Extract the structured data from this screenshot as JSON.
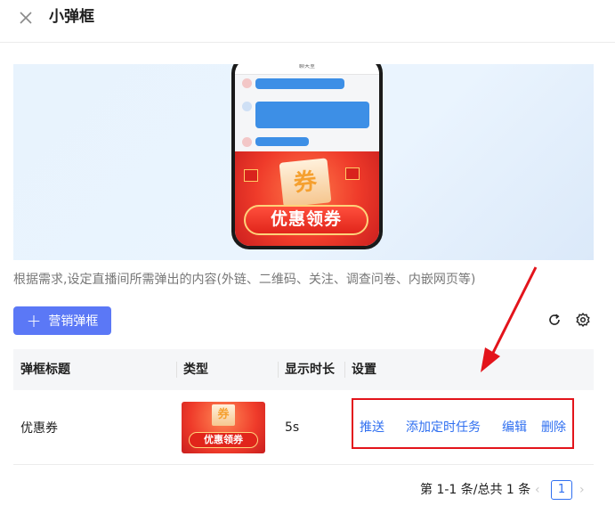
{
  "header": {
    "title": "小弹框",
    "close_icon": "close-icon"
  },
  "banner": {
    "chat_title": "聊天室",
    "promo_ticket_char": "券",
    "promo_button_label": "优惠领券"
  },
  "description": "根据需求,设定直播间所需弹出的内容(外链、二维码、关注、调查问卷、内嵌网页等)",
  "toolbar": {
    "add_label": "营销弹框",
    "add_icon": "plus-icon",
    "refresh_icon": "refresh-icon",
    "settings_icon": "gear-icon",
    "primary_color": "#5b78f6"
  },
  "table": {
    "columns": [
      "弹框标题",
      "类型",
      "显示时长",
      "设置"
    ],
    "rows": [
      {
        "title": "优惠券",
        "type_thumb_ticket": "券",
        "type_thumb_label": "优惠领券",
        "duration": "5s",
        "actions": [
          "推送",
          "添加定时任务",
          "编辑",
          "删除"
        ]
      }
    ]
  },
  "pagination": {
    "summary": "第 1-1 条/总共 1 条",
    "current_page": "1",
    "prev_icon": "chevron-left-icon",
    "next_icon": "chevron-right-icon"
  },
  "colors": {
    "link": "#2f6ff0",
    "highlight": "#e3141b"
  }
}
